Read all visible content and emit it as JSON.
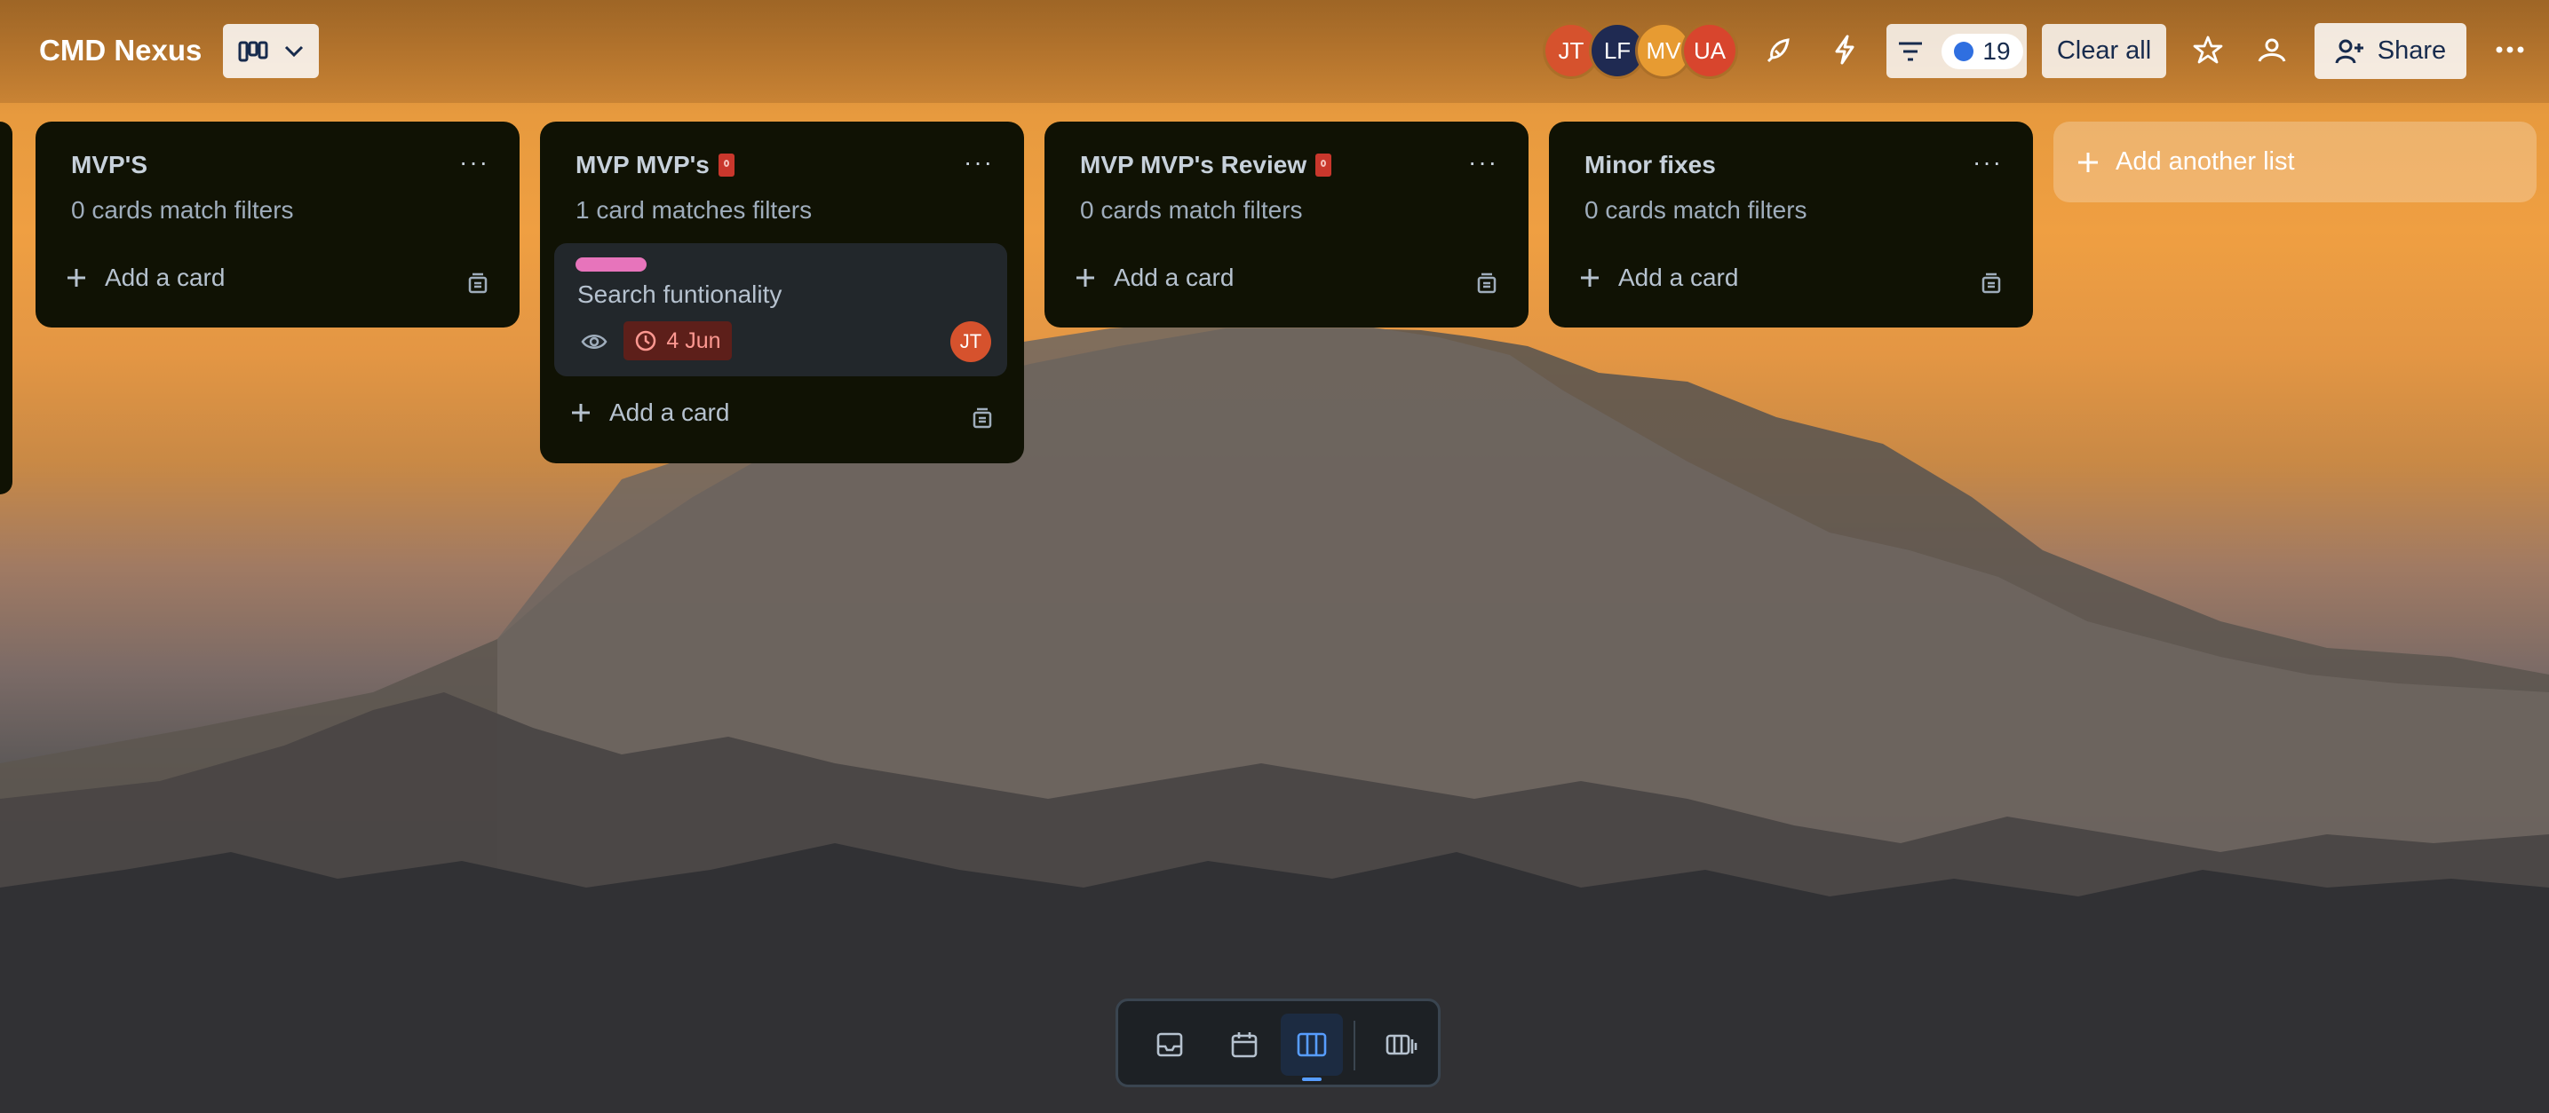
{
  "board": {
    "title": "CMD Nexus"
  },
  "header": {
    "members": [
      {
        "initials": "JT",
        "color": "#d6522d"
      },
      {
        "initials": "LF",
        "color": "#1f2a52"
      },
      {
        "initials": "MV",
        "color": "#e79b32"
      },
      {
        "initials": "UA",
        "color": "#d8452d"
      }
    ],
    "filter_count": "19",
    "clear_all_label": "Clear all",
    "share_label": "Share"
  },
  "lists": [
    {
      "title": "MVP'S",
      "subtitle": "0 cards match filters",
      "add_card_label": "Add a card"
    },
    {
      "title": "MVP MVP's",
      "subtitle": "1 card matches filters",
      "add_card_label": "Add a card",
      "cards": [
        {
          "title": "Search funtionality",
          "label_color": "#e774bb",
          "due": "4 Jun",
          "member": "JT"
        }
      ]
    },
    {
      "title": "MVP MVP's Review",
      "subtitle": "0 cards match filters",
      "add_card_label": "Add a card"
    },
    {
      "title": "Minor fixes",
      "subtitle": "0 cards match filters",
      "add_card_label": "Add a card"
    }
  ],
  "add_list_label": "Add another list",
  "view_switcher": {
    "items": [
      "inbox-icon",
      "calendar-icon",
      "board-icon",
      "switch-boards-icon"
    ],
    "active": "board-icon"
  }
}
